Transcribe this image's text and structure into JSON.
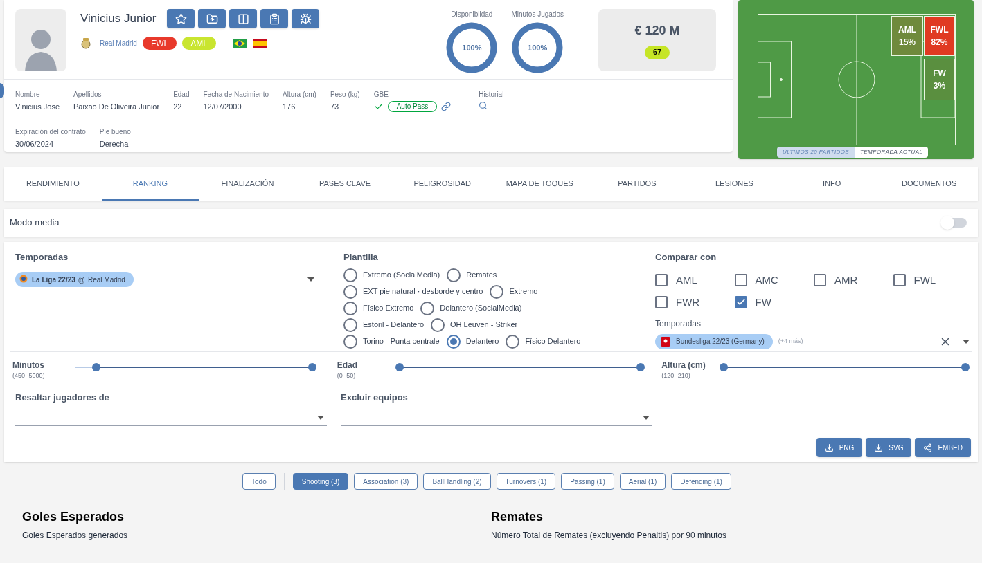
{
  "player": {
    "name": "Vinicius Junior",
    "club": "Real Madrid",
    "positions": [
      {
        "label": "FWL",
        "color": "#e8392b"
      },
      {
        "label": "AML",
        "color": "#c9e52f"
      }
    ],
    "flags": [
      {
        "kind": "brazil"
      },
      {
        "kind": "spain"
      }
    ]
  },
  "stats": [
    {
      "label": "Disponiblidad",
      "value": "100%",
      "level": 1
    },
    {
      "label": "Minutos Jugados",
      "value": "100%",
      "level": 1
    }
  ],
  "market": {
    "value": "€ 120 M",
    "rating": "67"
  },
  "details": [
    {
      "label": "Nombre",
      "value": "Vinicius Jose"
    },
    {
      "label": "Apellidos",
      "value": "Paixao De Oliveira Junior"
    },
    {
      "label": "Edad",
      "value": "22"
    },
    {
      "label": "Fecha de Nacimiento",
      "value": "12/07/2000"
    },
    {
      "label": "Altura (cm)",
      "value": "176"
    },
    {
      "label": "Peso (kg)",
      "value": "73"
    }
  ],
  "gbe": {
    "label": "GBE",
    "status": "Auto Pass"
  },
  "history": {
    "label": "Historial"
  },
  "details_2": [
    {
      "label": "Expiración del contrato",
      "value": "30/06/2024"
    },
    {
      "label": "Pie bueno",
      "value": "Derecha"
    }
  ],
  "pitch": {
    "zones": [
      {
        "label": "AML",
        "value": "15%",
        "color": "#6f8a3c"
      },
      {
        "label": "FWL",
        "value": "82%",
        "color": "#e03a22"
      },
      {
        "label": "FW",
        "value": "3%",
        "color": "#5a8f3f"
      }
    ],
    "toggle": [
      {
        "label": "ÚLTIMOS 20 PARTIDOS",
        "selected": true
      },
      {
        "label": "TEMPORADA ACTUAL",
        "selected": false
      }
    ]
  },
  "tabs": [
    {
      "label": "RENDIMIENTO",
      "selected": false
    },
    {
      "label": "RANKING",
      "selected": true
    },
    {
      "label": "FINALIZACIÓN",
      "selected": false
    },
    {
      "label": "PASES CLAVE",
      "selected": false
    },
    {
      "label": "PELIGROSIDAD",
      "selected": false
    },
    {
      "label": "MAPA DE TOQUES",
      "selected": false
    },
    {
      "label": "PARTIDOS",
      "selected": false
    },
    {
      "label": "LESIONES",
      "selected": false
    },
    {
      "label": "INFO",
      "selected": false
    },
    {
      "label": "DOCUMENTOS",
      "selected": false
    }
  ],
  "mode": {
    "label": "Modo media",
    "on": false
  },
  "seasons": {
    "label": "Temporadas",
    "chip_bold": "La Liga 22/23",
    "chip_at": "@",
    "chip_team": "Real Madrid"
  },
  "template": {
    "label": "Plantilla",
    "rows": [
      {
        "options": [
          {
            "label": "Extremo (SocialMedia)",
            "selected": false
          },
          {
            "label": "Remates",
            "selected": false
          }
        ]
      },
      {
        "options": [
          {
            "label": "EXT pie natural · desborde y centro",
            "selected": false
          },
          {
            "label": "Extremo",
            "selected": false
          }
        ]
      },
      {
        "options": [
          {
            "label": "Físico Extremo",
            "selected": false
          },
          {
            "label": "Delantero (SocialMedia)",
            "selected": false
          }
        ]
      },
      {
        "options": [
          {
            "label": "Estoril - Delantero",
            "selected": false
          },
          {
            "label": "OH Leuven - Striker",
            "selected": false
          }
        ]
      },
      {
        "options": [
          {
            "label": "Torino - Punta centrale",
            "selected": false
          },
          {
            "label": "Delantero",
            "selected": true
          },
          {
            "label": "Físico Delantero",
            "selected": false
          }
        ]
      }
    ]
  },
  "compare": {
    "label": "Comparar con",
    "positions": [
      {
        "label": "AML",
        "checked": false
      },
      {
        "label": "AMC",
        "checked": false
      },
      {
        "label": "AMR",
        "checked": false
      },
      {
        "label": "FWL",
        "checked": false
      },
      {
        "label": "FWR",
        "checked": false
      },
      {
        "label": "FW",
        "checked": true
      }
    ],
    "seasons_label": "Temporadas",
    "season_chip": "Bundesliga 22/23 (Germany)",
    "more": "(+4 más)"
  },
  "sliders": [
    {
      "label": "Minutos",
      "range": "(450- 5000)",
      "thumbs": [
        {
          "level": 0.09
        },
        {
          "level": 0.985
        }
      ]
    },
    {
      "label": "Edad",
      "range": "(0- 50)",
      "thumbs": [
        {
          "level": 0.0
        },
        {
          "level": 1.0
        }
      ]
    },
    {
      "label": "Altura (cm)",
      "range": "(120- 210)",
      "thumbs": [
        {
          "level": 0.0
        },
        {
          "level": 1.0
        }
      ]
    }
  ],
  "highlight": {
    "label": "Resaltar jugadores de"
  },
  "exclude": {
    "label": "Excluir equipos"
  },
  "exports": [
    {
      "label": "PNG",
      "kind": "download"
    },
    {
      "label": "SVG",
      "kind": "download"
    },
    {
      "label": "EMBED",
      "kind": "share"
    }
  ],
  "categories": [
    {
      "label": "Todo",
      "selected": false
    },
    {
      "label": "Shooting (3)",
      "selected": true
    },
    {
      "label": "Association (3)",
      "selected": false
    },
    {
      "label": "BallHandling (2)",
      "selected": false
    },
    {
      "label": "Turnovers (1)",
      "selected": false
    },
    {
      "label": "Passing (1)",
      "selected": false
    },
    {
      "label": "Aerial (1)",
      "selected": false
    },
    {
      "label": "Defending (1)",
      "selected": false
    }
  ],
  "metrics": [
    {
      "title": "Goles Esperados",
      "description": "Goles Esperados generados"
    },
    {
      "title": "Remates",
      "description": "Número Total de Remates (excluyendo Penaltis) por 90 minutos"
    }
  ]
}
